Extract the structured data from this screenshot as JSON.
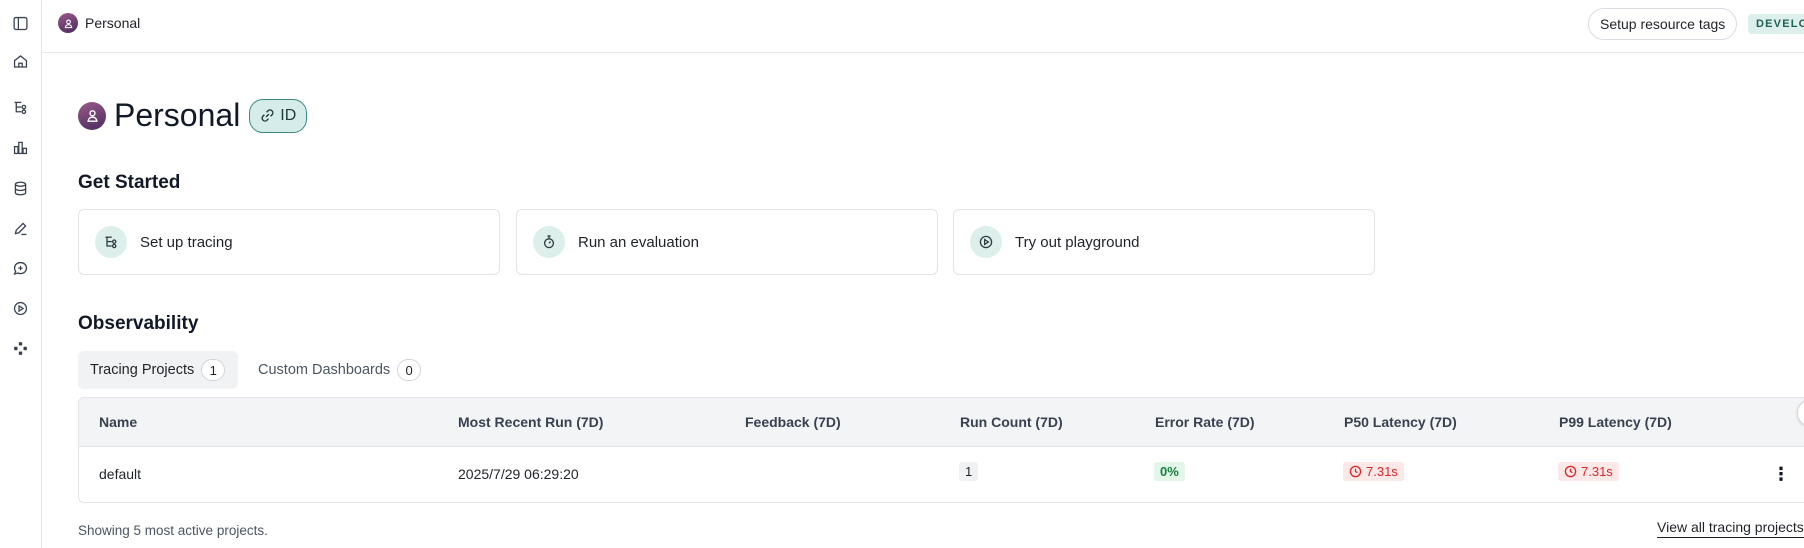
{
  "sidebar": {
    "items": [
      {
        "icon": "panel-toggle-icon"
      },
      {
        "icon": "home-icon"
      },
      {
        "icon": "tracing-icon"
      },
      {
        "icon": "dashboards-icon"
      },
      {
        "icon": "datasets-icon"
      },
      {
        "icon": "annotation-icon"
      },
      {
        "icon": "prompts-icon"
      },
      {
        "icon": "playground-icon"
      },
      {
        "icon": "deployments-icon"
      }
    ]
  },
  "topbar": {
    "workspace": "Personal",
    "tags_button": "Setup resource tags",
    "env_badge": "DEVELOPER"
  },
  "header": {
    "title": "Personal",
    "id_chip": "ID"
  },
  "get_started": {
    "title": "Get Started",
    "cards": [
      {
        "label": "Set up tracing",
        "icon": "tracing-icon"
      },
      {
        "label": "Run an evaluation",
        "icon": "stopwatch-icon"
      },
      {
        "label": "Try out playground",
        "icon": "play-circle-icon"
      }
    ]
  },
  "observability": {
    "title": "Observability",
    "tabs": [
      {
        "label": "Tracing Projects",
        "count": "1",
        "active": true
      },
      {
        "label": "Custom Dashboards",
        "count": "0",
        "active": false
      }
    ],
    "table": {
      "columns": [
        "Name",
        "Most Recent Run (7D)",
        "Feedback (7D)",
        "Run Count (7D)",
        "Error Rate (7D)",
        "P50 Latency (7D)",
        "P99 Latency (7D)"
      ],
      "rows": [
        {
          "name": "default",
          "most_recent_run": "2025/7/29 06:29:20",
          "feedback": "",
          "run_count": "1",
          "error_rate": "0%",
          "p50_latency": "7.31s",
          "p99_latency": "7.31s"
        }
      ]
    },
    "footer_note": "Showing 5 most active projects.",
    "view_all": "View all tracing projects →"
  },
  "colors": {
    "accent_bg": "#dcefeb",
    "accent_border": "#3a8a80",
    "success": "#15803d",
    "danger": "#dc2626"
  }
}
